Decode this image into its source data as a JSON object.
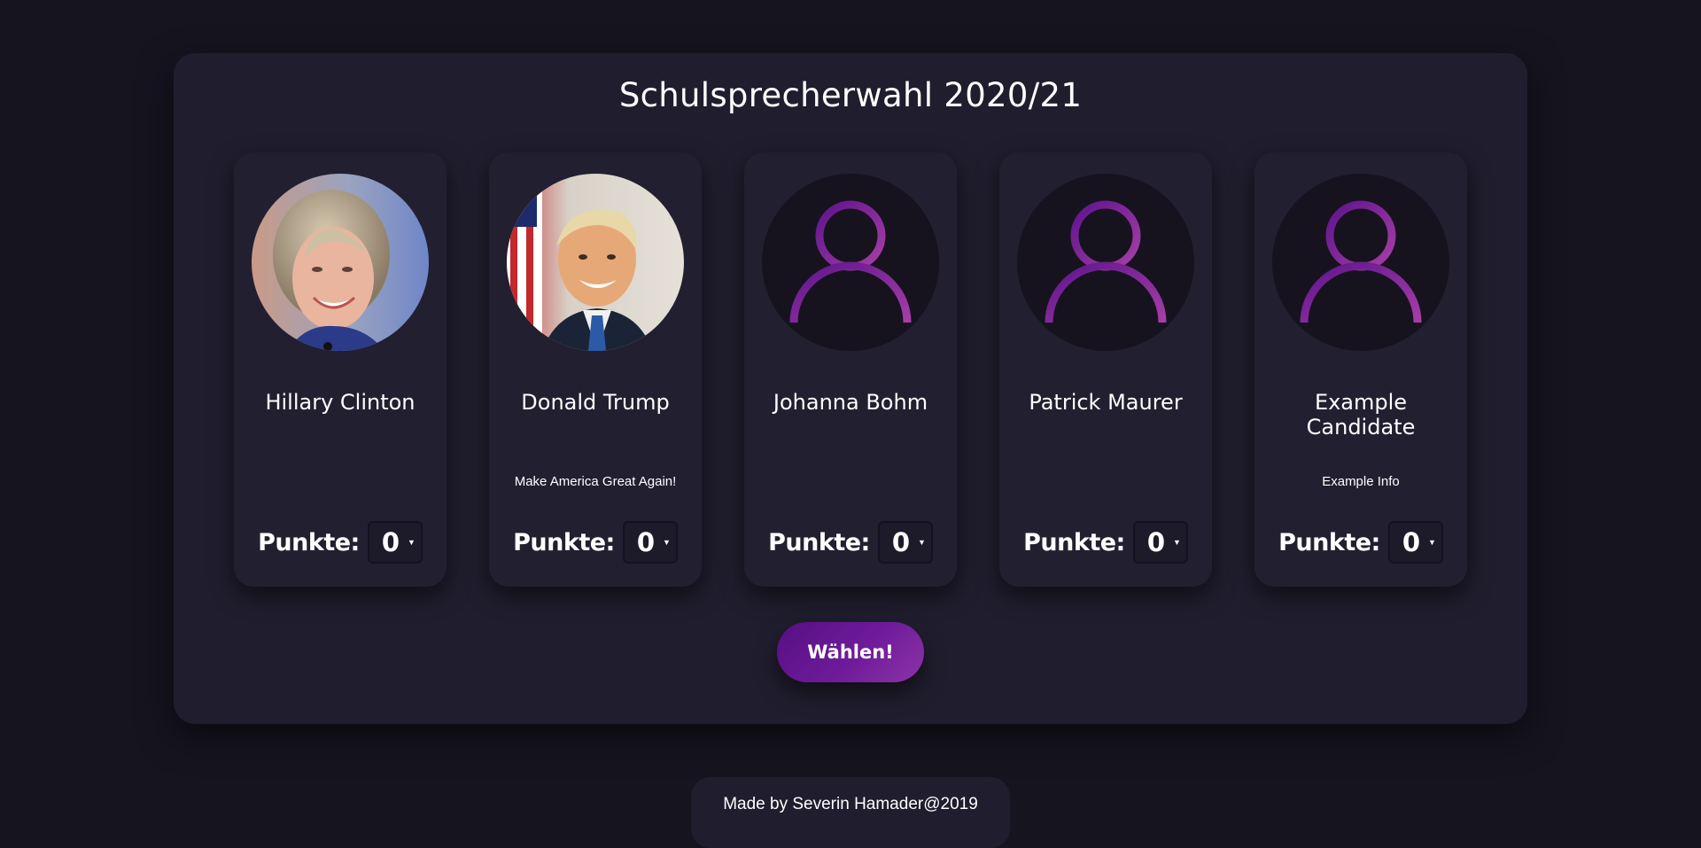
{
  "page": {
    "title": "Schulsprecherwahl 2020/21"
  },
  "candidates": [
    {
      "name": "Hillary Clinton",
      "info": "",
      "points_label": "Punkte:",
      "points_value": "0",
      "avatar": "photo-portrait-blonde-woman"
    },
    {
      "name": "Donald Trump",
      "info": "Make America Great Again!",
      "points_label": "Punkte:",
      "points_value": "0",
      "avatar": "photo-portrait-man-with-flag"
    },
    {
      "name": "Johanna Bohm",
      "info": "",
      "points_label": "Punkte:",
      "points_value": "0",
      "avatar": "user-placeholder-icon"
    },
    {
      "name": "Patrick Maurer",
      "info": "",
      "points_label": "Punkte:",
      "points_value": "0",
      "avatar": "user-placeholder-icon"
    },
    {
      "name": "Example Candidate",
      "info": "Example Info",
      "points_label": "Punkte:",
      "points_value": "0",
      "avatar": "user-placeholder-icon"
    }
  ],
  "vote_button": {
    "label": "Wählen!"
  },
  "footer": {
    "text": "Made by Severin Hamader@2019"
  },
  "colors": {
    "background": "#16141f",
    "panel": "#201d2e",
    "card": "#221f31",
    "accent": "#6e1b9a",
    "text": "#ffffff"
  }
}
